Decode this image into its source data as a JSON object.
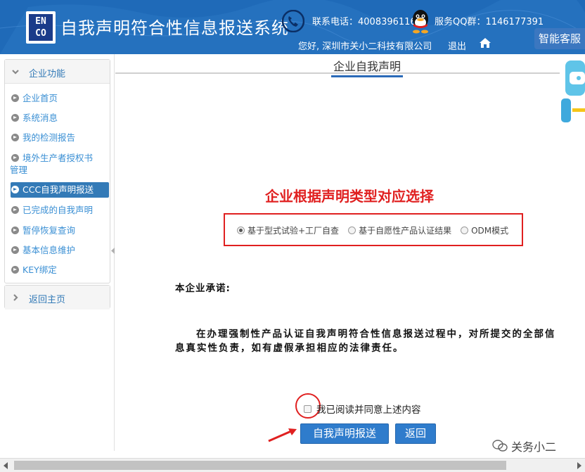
{
  "header": {
    "logo_text": "EN\nCO",
    "title": "自我声明符合性信息报送系统",
    "contact_label": "联系电话：",
    "contact_phone": "4008396116",
    "qq_label": "服务QQ群：",
    "qq_number": "1146177391",
    "greeting": "您好, 深圳市关小二科技有限公司",
    "logout": "退出"
  },
  "service": {
    "label": "智能客服"
  },
  "sidebar": {
    "section_title": "企业功能",
    "items": [
      {
        "label": "企业首页"
      },
      {
        "label": "系统消息"
      },
      {
        "label": "我的检测报告"
      },
      {
        "label": "境外生产者授权书"
      },
      {
        "label": "管理"
      },
      {
        "label": "CCC自我声明报送"
      },
      {
        "label": "已完成的自我声明"
      },
      {
        "label": "暂停恢复查询"
      },
      {
        "label": "基本信息维护"
      },
      {
        "label": "KEY绑定"
      }
    ],
    "back_home": "返回主页"
  },
  "main": {
    "page_title": "企业自我声明",
    "annotation_heading": "企业根据声明类型对应选择",
    "radio_options": [
      {
        "label": "基于型式试验+工厂自查",
        "checked": true
      },
      {
        "label": "基于自愿性产品认证结果",
        "checked": false
      },
      {
        "label": "ODM模式",
        "checked": false
      }
    ],
    "pledge_title": "本企业承诺:",
    "pledge_text": "在办理强制性产品认证自我声明符合性信息报送过程中，对所提交的全部信息真实性负责，如有虚假承担相应的法律责任。",
    "agree_label": "我已阅读并同意上述内容",
    "submit_button": "自我声明报送",
    "back_button": "返回"
  },
  "watermark": {
    "text": "关务小二"
  },
  "colors": {
    "header_bg": "#1f6ab8",
    "accent": "#337ab7",
    "annotation_red": "#e02020"
  }
}
